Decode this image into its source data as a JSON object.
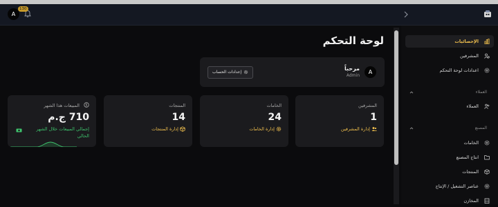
{
  "header": {
    "avatar_initial": "A",
    "notification_count": "130"
  },
  "main": {
    "title": "لوحة التحكم",
    "welcome": {
      "greeting": "مرحباً",
      "role": "Admin",
      "avatar_initial": "A",
      "account_button": "إعدادات الحساب"
    },
    "cards": [
      {
        "label": "المشرفين",
        "value": "1",
        "link": "إدارة المشرفين",
        "icon": "users-icon"
      },
      {
        "label": "الخامات",
        "value": "24",
        "link": "إدارة الخامات",
        "icon": "gear-icon"
      },
      {
        "label": "المنتجات",
        "value": "14",
        "link": "إدارة المنتجات",
        "icon": "box-icon"
      },
      {
        "label": "المبيعات هذا الشهر",
        "value": "710 ج.م",
        "link": "إجمالي المبيعات خلال الشهر الحالي",
        "icon": "money-icon"
      }
    ]
  },
  "sidebar": {
    "items": [
      {
        "label": "الإحصائيات",
        "icon": "chart-bars-icon",
        "active": true
      },
      {
        "label": "المشرفين",
        "icon": "users-cog-icon"
      },
      {
        "label": "اعدادات لوحة التحكم",
        "icon": "settings-icon"
      }
    ],
    "group_customers": {
      "title": "العملاء",
      "items": [
        {
          "label": "العملاء",
          "icon": "customers-icon"
        }
      ]
    },
    "group_factory": {
      "title": "المصنع",
      "items": [
        {
          "label": "الخامات",
          "icon": "gear-icon"
        },
        {
          "label": "انتاج المصنع",
          "icon": "folder-icon"
        },
        {
          "label": "المنتجات",
          "icon": "box-icon"
        },
        {
          "label": "عناصر التشغيل / الإنتاج",
          "icon": "cog-icon"
        },
        {
          "label": "المخازن",
          "icon": "warehouse-icon"
        }
      ]
    }
  },
  "colors": {
    "accent": "#f2c14e",
    "success": "#3ec46d",
    "background": "#0b0b0d",
    "card": "#1b1b1e"
  }
}
